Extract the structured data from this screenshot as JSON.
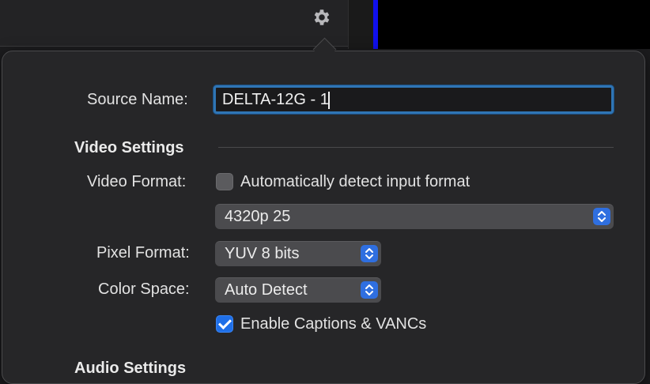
{
  "form": {
    "source_name_label": "Source Name:",
    "source_name_value": "DELTA-12G - 1",
    "video_settings_title": "Video Settings",
    "video_format_label": "Video Format:",
    "auto_detect_label": "Automatically detect input format",
    "auto_detect_checked": false,
    "video_format_value": "4320p 25",
    "pixel_format_label": "Pixel Format:",
    "pixel_format_value": "YUV 8 bits",
    "color_space_label": "Color Space:",
    "color_space_value": "Auto Detect",
    "captions_label": "Enable Captions & VANCs",
    "captions_checked": true,
    "audio_settings_title": "Audio Settings"
  },
  "icons": {
    "settings": "gear-icon",
    "popup_stepper": "up-down-chevron-icon"
  },
  "colors": {
    "accent": "#2f75b5",
    "checkbox_on": "#1f6fe8",
    "preview_edge": "#1010ee"
  }
}
